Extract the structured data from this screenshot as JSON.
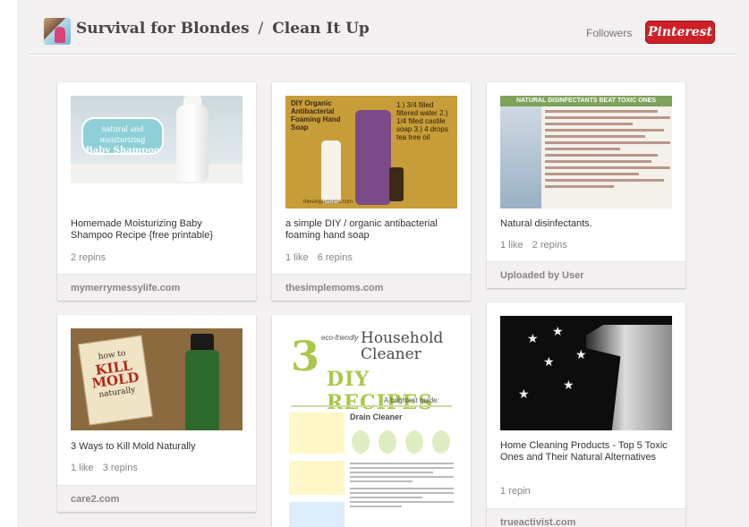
{
  "header": {
    "user": "Survival for Blondes",
    "separator": "/",
    "board": "Clean It Up",
    "followers": "Followers",
    "pinterest_button": "Pinterest"
  },
  "pins": [
    {
      "description": "Homemade Moisturizing Baby Shampoo Recipe {free printable}",
      "likes": "",
      "repins": "2 repins",
      "source": "mymerrymessylife.com",
      "image_text": [
        "natural and moisturizing",
        "Baby Shampoo"
      ]
    },
    {
      "description": "a simple DIY / organic antibacterial foaming hand soap",
      "likes": "1 like",
      "repins": "6 repins",
      "source": "thesimplemoms.com",
      "image_text": [
        "DIY Organic Antibacterial Foaming Hand Soap",
        "1.) 3/4 filled filtered water 2.) 1/4 filled castile soap 3.) 4 drops tea tree oil",
        "thesimplemoms.com"
      ]
    },
    {
      "description": "Natural disinfectants.",
      "likes": "1 like",
      "repins": "2 repins",
      "source": "Uploaded by User",
      "image_text": [
        "NATURAL DISINFECTANTS BEAT TOXIC ONES"
      ]
    },
    {
      "description": "3 Ways to Kill Mold Naturally",
      "likes": "1 like",
      "repins": "3 repins",
      "source": "care2.com",
      "image_text": [
        "how to",
        "KILL MOLD",
        "naturally"
      ]
    },
    {
      "description": "",
      "likes": "",
      "repins": "",
      "source": "",
      "image_text": [
        "3",
        "eco-friendly",
        "Household Cleaner",
        "DIY RECIPES",
        "A brightest guide:",
        "Drain Cleaner"
      ]
    },
    {
      "description": "Home Cleaning Products - Top 5 Toxic Ones and Their Natural Alternatives",
      "likes": "",
      "repins": "1 repin",
      "source": "trueactivist.com",
      "image_text": []
    }
  ],
  "colors": {
    "pinterest_red": "#cb2027",
    "board_background": "#f2f0f0"
  }
}
